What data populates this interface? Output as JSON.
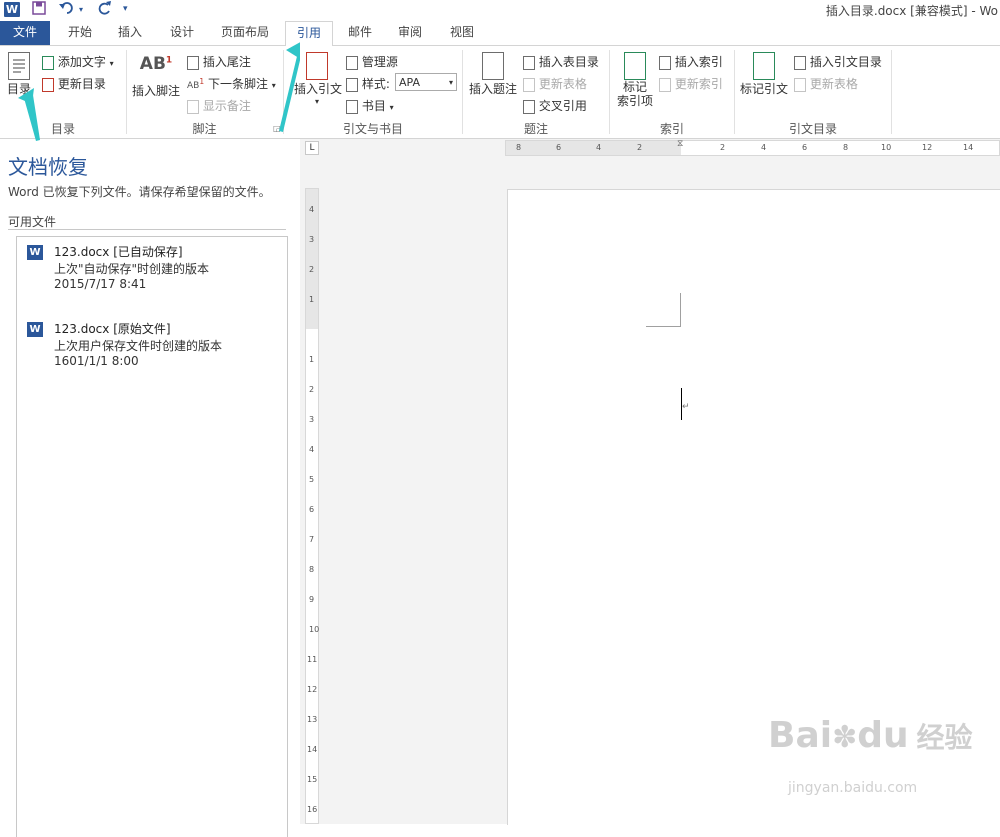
{
  "window": {
    "title": "插入目录.docx [兼容模式] - Wo"
  },
  "tabs": [
    {
      "label": "文件"
    },
    {
      "label": "开始"
    },
    {
      "label": "插入"
    },
    {
      "label": "设计"
    },
    {
      "label": "页面布局"
    },
    {
      "label": "引用"
    },
    {
      "label": "邮件"
    },
    {
      "label": "审阅"
    },
    {
      "label": "视图"
    }
  ],
  "active_tab": "引用",
  "ribbon": {
    "toc": {
      "toc_button": "目录",
      "add_text": "添加文字",
      "update_toc": "更新目录",
      "group_label": "目录"
    },
    "footnotes": {
      "insert_footnote": "插入脚注",
      "insert_endnote": "插入尾注",
      "next_footnote": "下一条脚注",
      "show_notes": "显示备注",
      "group_label": "脚注",
      "ab_icon": "AB"
    },
    "citations": {
      "insert_citation": "插入引文",
      "manage_sources": "管理源",
      "style_label": "样式:",
      "style_value": "APA",
      "bibliography": "书目",
      "group_label": "引文与书目"
    },
    "captions": {
      "insert_caption": "插入题注",
      "insert_table_of_figures": "插入表目录",
      "update_table": "更新表格",
      "cross_reference": "交叉引用",
      "group_label": "题注"
    },
    "index": {
      "mark_entry_line1": "标记",
      "mark_entry_line2": "索引项",
      "insert_index": "插入索引",
      "update_index": "更新索引",
      "group_label": "索引"
    },
    "table_of_authorities": {
      "mark_citation": "标记引文",
      "insert_toa": "插入引文目录",
      "update_table": "更新表格",
      "group_label": "引文目录"
    }
  },
  "recovery_pane": {
    "title": "文档恢复",
    "description": "Word 已恢复下列文件。请保存希望保留的文件。",
    "available_files_label": "可用文件",
    "files": [
      {
        "name": "123.docx  [已自动保存]",
        "description": "上次\"自动保存\"时创建的版本",
        "date": "2015/7/17 8:41"
      },
      {
        "name": "123.docx  [原始文件]",
        "description": "上次用户保存文件时创建的版本",
        "date": "1601/1/1 8:00"
      }
    ]
  },
  "ruler": {
    "horizontal_numbers": [
      "8",
      "6",
      "4",
      "2",
      "2",
      "4",
      "6",
      "8",
      "10",
      "12",
      "14"
    ],
    "vertical_numbers": [
      "4",
      "3",
      "2",
      "1",
      "1",
      "2",
      "3",
      "4",
      "5",
      "6",
      "7",
      "8",
      "9",
      "10",
      "11",
      "12",
      "13",
      "14",
      "15",
      "16"
    ],
    "tab_selector": "L"
  },
  "watermark": {
    "brand": "Bai",
    "brand2": "du",
    "cn": "经验",
    "url": "jingyan.baidu.com"
  },
  "colors": {
    "accent": "#2b579a",
    "arrow": "#30c5c8"
  }
}
